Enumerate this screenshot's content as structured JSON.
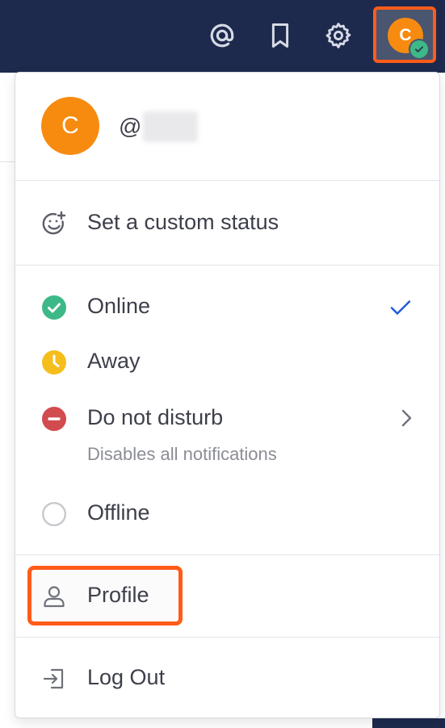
{
  "header": {
    "avatar_initial": "C",
    "icons": [
      "at-sign-icon",
      "bookmark-icon",
      "gear-icon"
    ]
  },
  "menu": {
    "user": {
      "avatar_initial": "C",
      "handle_prefix": "@"
    },
    "custom_status": {
      "label": "Set a custom status",
      "icon": "smile-plus-icon"
    },
    "statuses": [
      {
        "label": "Online",
        "icon": "online-check-icon",
        "color": "#3db887",
        "selected": true
      },
      {
        "label": "Away",
        "icon": "clock-icon",
        "color": "#f5be1c",
        "selected": false
      },
      {
        "label": "Do not disturb",
        "icon": "minus-circle-icon",
        "color": "#d24b4e",
        "selected": false,
        "sublabel": "Disables all notifications"
      },
      {
        "label": "Offline",
        "icon": "empty-circle-icon",
        "color": "#c8c9ce",
        "selected": false
      }
    ],
    "profile": {
      "label": "Profile",
      "icon": "user-icon"
    },
    "logout": {
      "label": "Log Out",
      "icon": "logout-icon"
    }
  },
  "colors": {
    "header_bg": "#1e2a4d",
    "avatar": "#f78b10",
    "highlight": "#ff5c1a",
    "check": "#1c58d9"
  }
}
